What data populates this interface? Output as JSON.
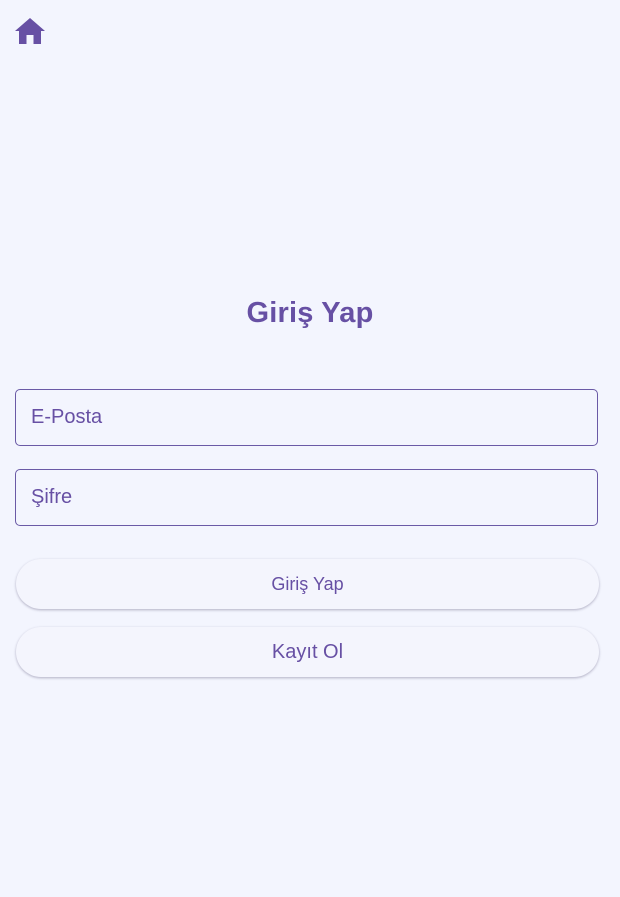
{
  "app": {
    "home_icon": "home-icon",
    "accent_color": "#6750a4",
    "background_color": "#f3f5fe"
  },
  "login": {
    "title": "Giriş Yap",
    "email_placeholder": "E-Posta",
    "email_value": "",
    "password_placeholder": "Şifre",
    "password_value": "",
    "login_button_label": "Giriş Yap",
    "register_button_label": "Kayıt Ol"
  }
}
